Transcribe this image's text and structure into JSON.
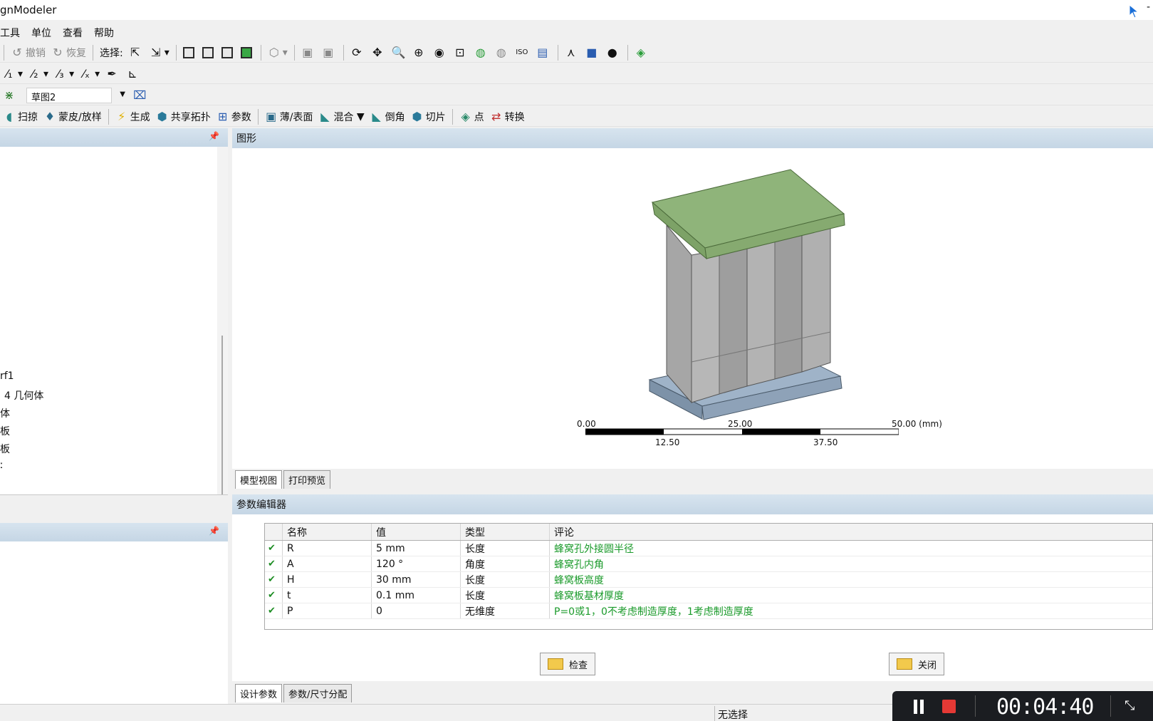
{
  "window": {
    "title": "gnModeler",
    "minimize_glyph": "-"
  },
  "menu": [
    "工具",
    "单位",
    "查看",
    "帮助"
  ],
  "toolbar1": {
    "undo": "撤销",
    "redo": "恢复",
    "select_label": "选择:"
  },
  "toolbar3": {
    "sketch_value": "草图2"
  },
  "toolbar4": {
    "sweep": "扫掠",
    "skin": "蒙皮/放样",
    "generate": "生成",
    "share_topology": "共享拓扑",
    "parameters": "参数",
    "thin_surface": "薄/表面",
    "blend": "混合",
    "chamfer": "倒角",
    "slice": "切片",
    "point": "点",
    "convert": "转换"
  },
  "tree": {
    "items": [
      "rf1",
      "4 几何体",
      "体",
      "板",
      "板",
      "​"
    ]
  },
  "graphics": {
    "header": "图形",
    "scale": {
      "t0": "0.00",
      "t1": "25.00",
      "t2": "50.00 (mm)",
      "b1": "12.50",
      "b2": "37.50"
    },
    "tabs": [
      "模型视图",
      "打印预览"
    ]
  },
  "param_editor": {
    "header": "参数编辑器",
    "columns": [
      "名称",
      "值",
      "类型",
      "评论"
    ],
    "rows": [
      {
        "check": "✔",
        "name": "R",
        "value": "5 mm",
        "type": "长度",
        "comment": "蜂窝孔外接圆半径"
      },
      {
        "check": "✔",
        "name": "A",
        "value": "120 °",
        "type": "角度",
        "comment": "蜂窝孔内角"
      },
      {
        "check": "✔",
        "name": "H",
        "value": "30 mm",
        "type": "长度",
        "comment": "蜂窝板高度"
      },
      {
        "check": "✔",
        "name": "t",
        "value": "0.1 mm",
        "type": "长度",
        "comment": "蜂窝板基材厚度"
      },
      {
        "check": "✔",
        "name": "P",
        "value": "0",
        "type": "无维度",
        "comment": "P=0或1，0不考虑制造厚度，1考虑制造厚度"
      }
    ],
    "check_button": "检查",
    "close_button": "关闭",
    "tabs": [
      "设计参数",
      "参数/尺寸分配"
    ]
  },
  "status": {
    "selection": "无选择"
  },
  "recorder": {
    "time": "00:04:40"
  },
  "colors": {
    "panel_header": "#c5d6e5",
    "comment_green": "#1a9a2a",
    "top_plate": "#8fb47a",
    "base_plate": "#9fb3c8"
  }
}
